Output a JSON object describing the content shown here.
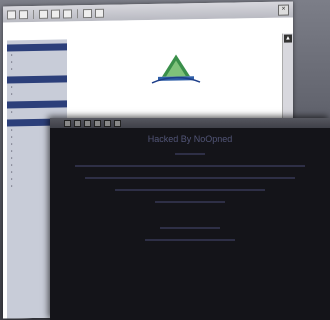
{
  "back_window": {
    "sidebar_sections": [
      {
        "items": [
          "",
          "",
          ""
        ]
      },
      {
        "items": [
          "",
          ""
        ]
      },
      {
        "items": [
          ""
        ]
      },
      {
        "items": [
          "",
          "",
          "",
          "",
          "",
          "",
          "",
          "",
          ""
        ]
      }
    ]
  },
  "front_window": {
    "title": "Hacked By NoOpned"
  },
  "colors": {
    "front_bg": "#141419",
    "back_bg": "#ffffff",
    "sidebar_bg": "#c8ccd8",
    "sidebar_header": "#2c3f7a"
  }
}
